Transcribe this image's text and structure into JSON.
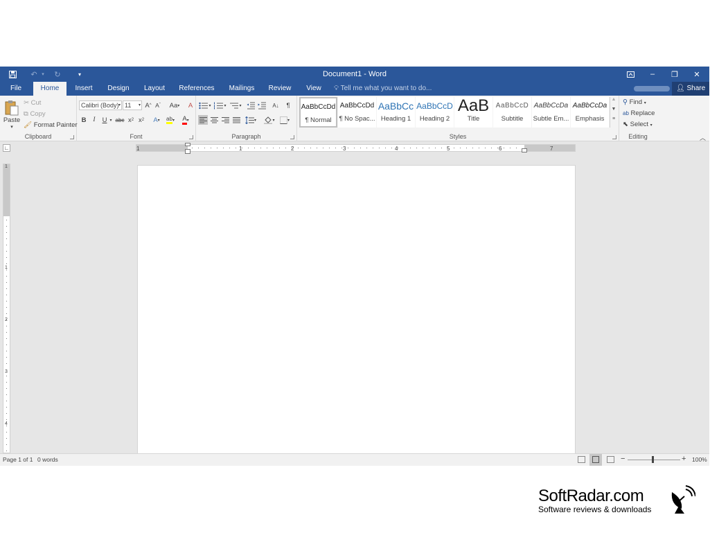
{
  "window": {
    "title": "Document1 - Word",
    "minimize": "–",
    "restore": "❐",
    "close": "✕",
    "ribbon_display": "⊡"
  },
  "quick_access": {
    "save": "💾",
    "undo": "↶",
    "redo": "↻",
    "customize": "▾"
  },
  "tabs": [
    "File",
    "Home",
    "Insert",
    "Design",
    "Layout",
    "References",
    "Mailings",
    "Review",
    "View"
  ],
  "active_tab": "Home",
  "tell_me": "Tell me what you want to do...",
  "share": "Share",
  "clipboard": {
    "paste": "Paste",
    "cut": "Cut",
    "copy": "Copy",
    "format_painter": "Format Painter",
    "label": "Clipboard"
  },
  "font": {
    "name": "Calibri (Body)",
    "size": "11",
    "grow": "A",
    "shrink": "A",
    "change_case": "Aa",
    "clear": "A",
    "bold": "B",
    "italic": "I",
    "underline": "U",
    "strike": "abc",
    "subscript": "x",
    "superscript": "x",
    "effects": "A",
    "highlight": "ab",
    "color": "A",
    "label": "Font"
  },
  "paragraph": {
    "show_marks": "¶",
    "sort": "A↓",
    "label": "Paragraph"
  },
  "styles": {
    "items": [
      {
        "preview": "AaBbCcDd",
        "name": "¶ Normal"
      },
      {
        "preview": "AaBbCcDd",
        "name": "¶ No Spac..."
      },
      {
        "preview": "AaBbCc",
        "name": "Heading 1"
      },
      {
        "preview": "AaBbCcD",
        "name": "Heading 2"
      },
      {
        "preview": "AaB",
        "name": "Title"
      },
      {
        "preview": "AaBbCcD",
        "name": "Subtitle"
      },
      {
        "preview": "AaBbCcDa",
        "name": "Subtle Em..."
      },
      {
        "preview": "AaBbCcDa",
        "name": "Emphasis"
      }
    ],
    "label": "Styles"
  },
  "editing": {
    "find": "Find",
    "replace": "Replace",
    "select": "Select",
    "label": "Editing"
  },
  "ruler": {
    "marks": [
      "1",
      "1",
      "2",
      "3",
      "4",
      "5",
      "6",
      "7"
    ],
    "vmarks": [
      "1",
      "1",
      "2",
      "3",
      "4"
    ]
  },
  "status": {
    "page": "Page 1 of 1",
    "words": "0 words",
    "zoom": "100%",
    "zoom_out": "−",
    "zoom_in": "+"
  },
  "watermark": {
    "title": "SoftRadar.com",
    "subtitle": "Software reviews & downloads"
  },
  "colors": {
    "brand": "#2b579a",
    "ribbon": "#f3f3f3",
    "canvas": "#e6e6e6",
    "highlight": "#ffff00",
    "font_color": "#ff0000"
  }
}
